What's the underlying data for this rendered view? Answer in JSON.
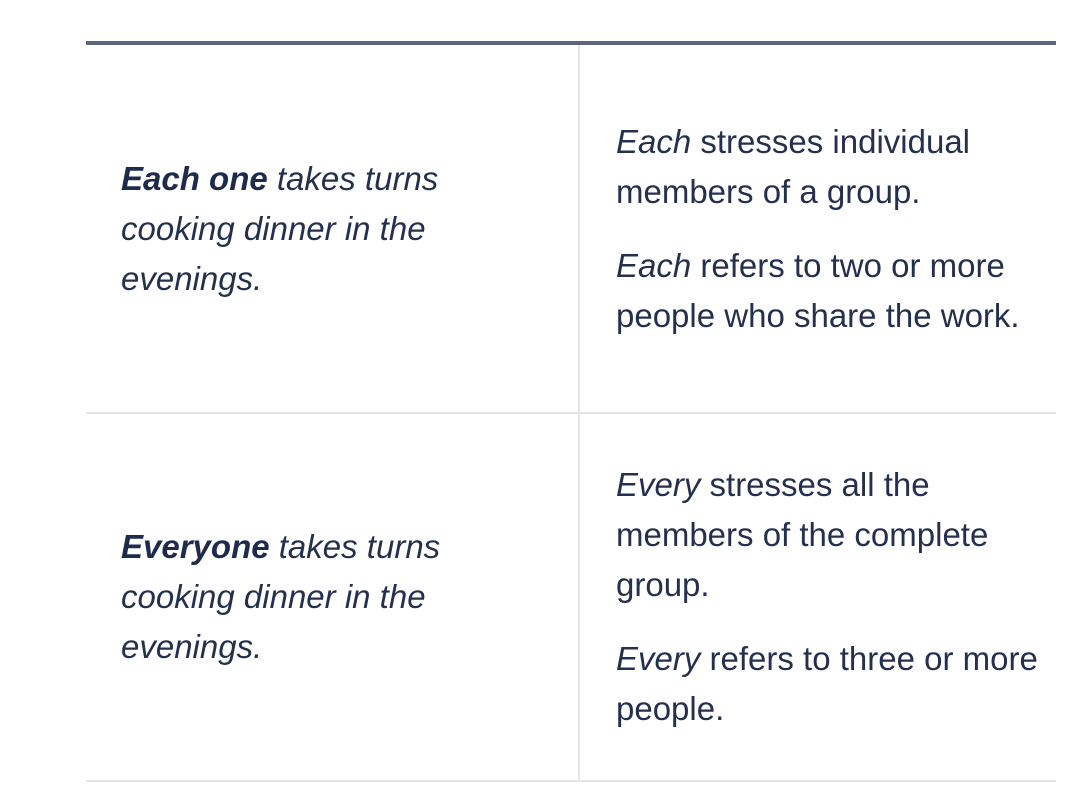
{
  "rows": [
    {
      "example": {
        "subject": "Each one",
        "rest": " takes turns cooking dinner in the evenings."
      },
      "notes": [
        {
          "key": "Each",
          "text": " stresses individual members of a group."
        },
        {
          "key": "Each",
          "text": " refers to two or more people who share the work."
        }
      ]
    },
    {
      "example": {
        "subject": "Everyone",
        "rest": " takes turns cooking dinner in the evenings."
      },
      "notes": [
        {
          "key": "Every",
          "text": " stresses all the members of the complete group."
        },
        {
          "key": "Every",
          "text": " refers to three or more people."
        }
      ]
    }
  ]
}
